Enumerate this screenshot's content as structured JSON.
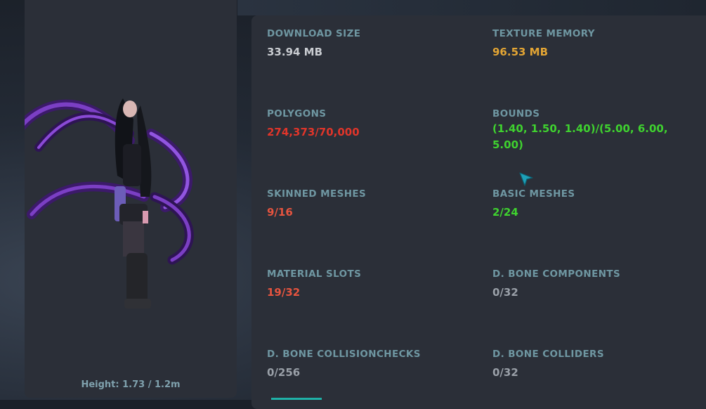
{
  "preview": {
    "height_text": "Height: 1.73 / 1.2m"
  },
  "stats": {
    "download_size": {
      "label": "DOWNLOAD SIZE",
      "value": "33.94 MB"
    },
    "texture_memory": {
      "label": "TEXTURE MEMORY",
      "value": "96.53 MB"
    },
    "polygons": {
      "label": "POLYGONS",
      "value": "274,373/70,000"
    },
    "bounds": {
      "label": "BOUNDS",
      "value": "(1.40, 1.50, 1.40)/(5.00, 6.00, 5.00)"
    },
    "skinned_meshes": {
      "label": "SKINNED MESHES",
      "value": "9/16"
    },
    "basic_meshes": {
      "label": "BASIC MESHES",
      "value": "2/24"
    },
    "material_slots": {
      "label": "MATERIAL SLOTS",
      "value": "19/32"
    },
    "d_bone_components": {
      "label": "D. BONE COMPONENTS",
      "value": "0/32"
    },
    "d_bone_collision_checks": {
      "label": "D. BONE COLLISIONCHECKS",
      "value": "0/256"
    },
    "d_bone_colliders": {
      "label": "D. BONE COLLIDERS",
      "value": "0/32"
    }
  },
  "colors": {
    "label": "#6f97a2",
    "neutral": "#c9ccd1",
    "warning": "#e3a534",
    "error": "#e0352a",
    "error_soft": "#e5543f",
    "ok": "#3fd22f",
    "muted": "#9aa0a8",
    "cursor": "#1ea0b8"
  },
  "icons": {
    "cursor": "mouse-pointer-icon"
  }
}
